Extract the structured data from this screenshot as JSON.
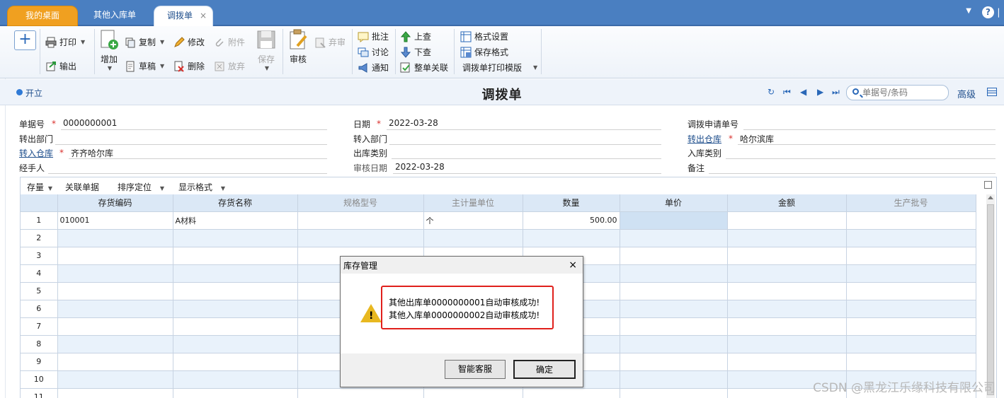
{
  "tabs": {
    "home": "我的桌面",
    "other_in": "其他入库单",
    "active": "调拨单",
    "close": "×"
  },
  "toolbar": {
    "new": "+",
    "print": "打印",
    "export": "输出",
    "add": "增加",
    "copy": "复制",
    "draft": "草稿",
    "modify": "修改",
    "delete": "删除",
    "attachment": "附件",
    "abandon": "放弃",
    "save": "保存",
    "audit": "审核",
    "discard": "弃审",
    "annotate": "批注",
    "discuss": "讨论",
    "notify": "通知",
    "prev_query": "上查",
    "next_query": "下查",
    "link_all": "整单关联",
    "format_settings": "格式设置",
    "save_format": "保存格式",
    "print_template": "调拨单打印模版"
  },
  "titlebar": {
    "status": "开立",
    "title": "调拨单",
    "search_placeholder": "单据号/条码",
    "advanced": "高级"
  },
  "form": {
    "doc_no_label": "单据号",
    "doc_no": "0000000001",
    "date_label": "日期",
    "date": "2022-03-28",
    "request_no_label": "调拨申请单号",
    "out_dept_label": "转出部门",
    "in_dept_label": "转入部门",
    "out_wh_label": "转出仓库",
    "out_wh": "哈尔滨库",
    "in_wh_label": "转入仓库",
    "in_wh": "齐齐哈尔库",
    "out_type_label": "出库类别",
    "in_type_label": "入库类别",
    "handler_label": "经手人",
    "audit_date_label": "审核日期",
    "audit_date": "2022-03-28",
    "remark_label": "备注",
    "required_mark": "*"
  },
  "grid_toolbar": {
    "stock": "存量",
    "related": "关联单据",
    "sort": "排序定位",
    "display": "显示格式"
  },
  "table": {
    "columns": [
      "",
      "存货编码",
      "存货名称",
      "规格型号",
      "主计量单位",
      "数量",
      "单价",
      "金额",
      "生产批号"
    ],
    "rows": [
      [
        "1",
        "010001",
        "A材料",
        "",
        "个",
        "500.00",
        "",
        "",
        ""
      ],
      [
        "2",
        "",
        "",
        "",
        "",
        "",
        "",
        "",
        ""
      ],
      [
        "3",
        "",
        "",
        "",
        "",
        "",
        "",
        "",
        ""
      ],
      [
        "4",
        "",
        "",
        "",
        "",
        "",
        "",
        "",
        ""
      ],
      [
        "5",
        "",
        "",
        "",
        "",
        "",
        "",
        "",
        ""
      ],
      [
        "6",
        "",
        "",
        "",
        "",
        "",
        "",
        "",
        ""
      ],
      [
        "7",
        "",
        "",
        "",
        "",
        "",
        "",
        "",
        ""
      ],
      [
        "8",
        "",
        "",
        "",
        "",
        "",
        "",
        "",
        ""
      ],
      [
        "9",
        "",
        "",
        "",
        "",
        "",
        "",
        "",
        ""
      ],
      [
        "10",
        "",
        "",
        "",
        "",
        "",
        "",
        "",
        ""
      ],
      [
        "11",
        "",
        "",
        "",
        "",
        "",
        "",
        "",
        ""
      ]
    ]
  },
  "dialog": {
    "title": "库存管理",
    "close": "×",
    "message1": "其他出库单0000000001自动审核成功!",
    "message2": "其他入库单0000000002自动审核成功!",
    "service_button": "智能客服",
    "ok_button": "确定"
  },
  "watermark": "CSDN @黑龙江乐缘科技有限公司",
  "colors": {
    "tabbar": "#4a7fc1",
    "home_tab": "#f0a020",
    "header_row": "#dbe8f6",
    "alt_row": "#e9f2fb",
    "highlight": "#e0201c"
  }
}
